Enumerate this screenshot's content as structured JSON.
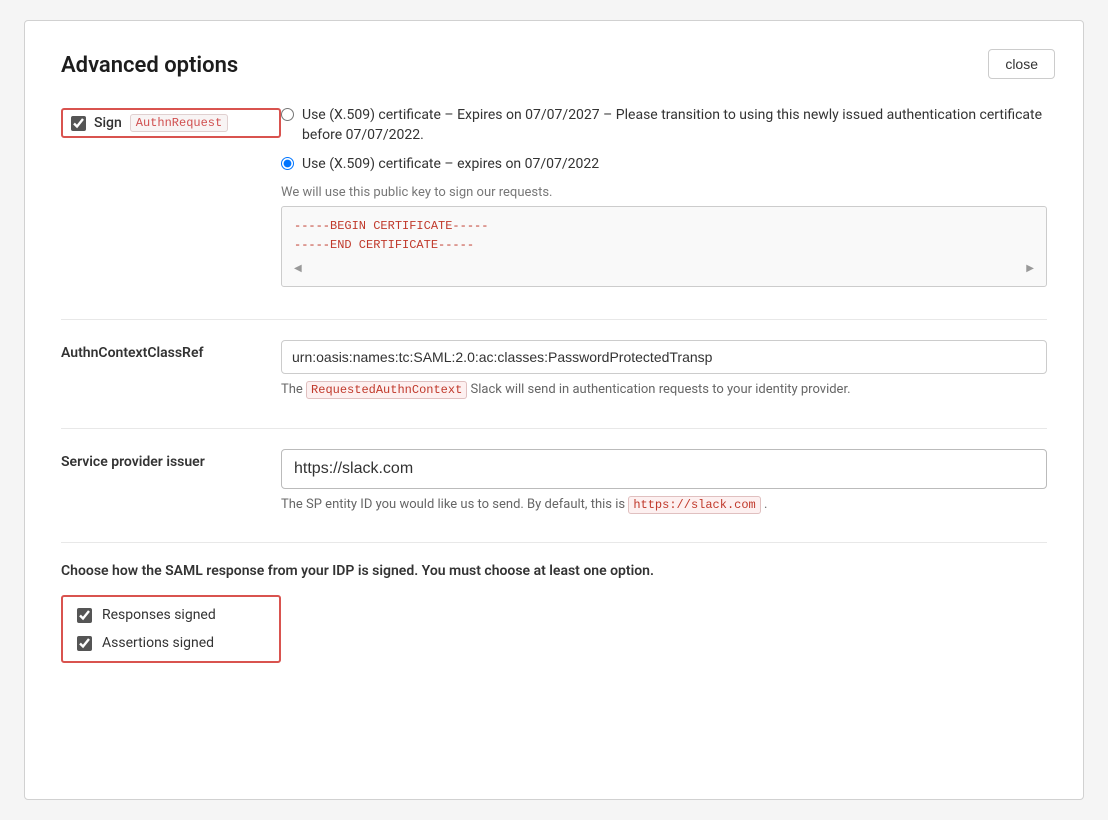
{
  "modal": {
    "title": "Advanced options",
    "close_button": "close"
  },
  "sign_authn": {
    "label": "Sign",
    "tag": "AuthnRequest",
    "checked": true
  },
  "certificate_options": {
    "option1": {
      "text": "Use (X.509) certificate – Expires on 07/07/2027 – Please transition to using this newly issued authentication certificate before 07/07/2022.",
      "selected": false
    },
    "option2": {
      "text": "Use (X.509) certificate – expires on 07/07/2022",
      "selected": true
    },
    "helper_text": "We will use this public key to sign our requests.",
    "cert_begin": "-----BEGIN CERTIFICATE-----",
    "cert_end": "-----END CERTIFICATE-----"
  },
  "authn_context": {
    "label": "AuthnContextClassRef",
    "value": "urn:oasis:names:tc:SAML:2.0:ac:classes:PasswordProtectedTransp",
    "tag": "RequestedAuthnContext",
    "description_before": "The",
    "description_after": "Slack will send in authentication requests to your identity provider."
  },
  "service_provider": {
    "label": "Service provider issuer",
    "value": "https://slack.com",
    "description_before": "The SP entity ID you would like us to send. By default, this is",
    "default_link": "https://slack.com",
    "description_after": "."
  },
  "saml_section": {
    "heading": "Choose how the SAML response from your IDP is signed. You must choose at least one option.",
    "responses_signed": {
      "label": "Responses signed",
      "checked": true
    },
    "assertions_signed": {
      "label": "Assertions signed",
      "checked": true
    }
  }
}
